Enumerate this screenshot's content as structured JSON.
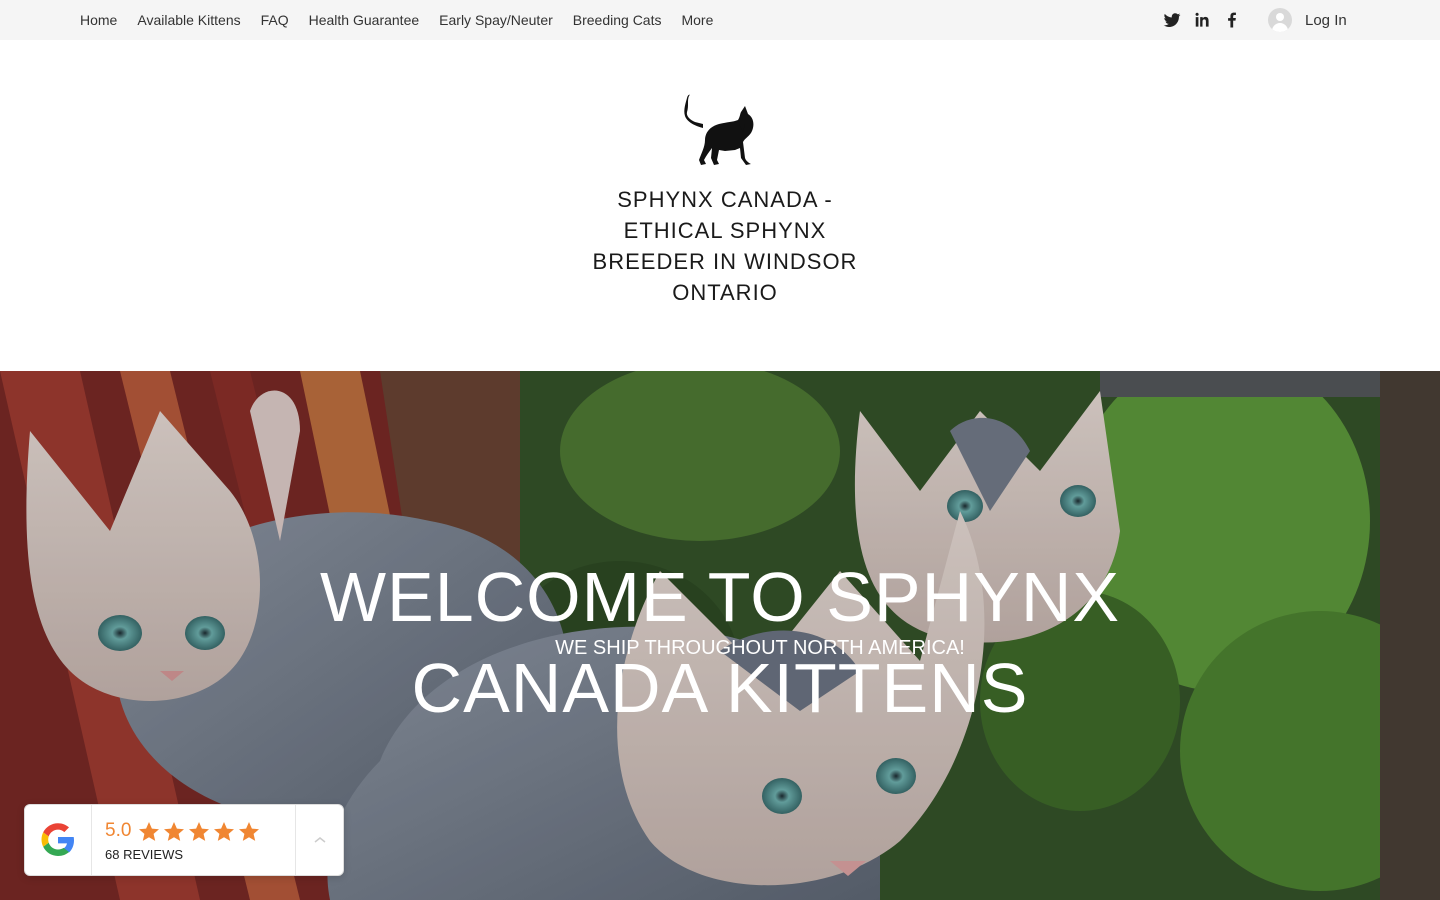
{
  "nav": {
    "items": [
      {
        "label": "Home"
      },
      {
        "label": "Available Kittens"
      },
      {
        "label": "FAQ"
      },
      {
        "label": "Health Guarantee"
      },
      {
        "label": "Early Spay/Neuter"
      },
      {
        "label": "Breeding Cats"
      },
      {
        "label": "More"
      }
    ]
  },
  "social": [
    "twitter-icon",
    "linkedin-icon",
    "facebook-icon"
  ],
  "login": {
    "label": "Log In"
  },
  "header": {
    "title": "SPHYNX CANADA - ETHICAL SPHYNX BREEDER IN WINDSOR ONTARIO"
  },
  "hero": {
    "title_line1": "WELCOME TO SPHYNX",
    "subtitle": "WE SHIP THROUGHOUT NORTH AMERICA!",
    "title_line2": "CANADA KITTENS"
  },
  "reviews": {
    "rating": "5.0",
    "stars": 5,
    "count_label": "68 REVIEWS",
    "star_color": "#f08632"
  }
}
